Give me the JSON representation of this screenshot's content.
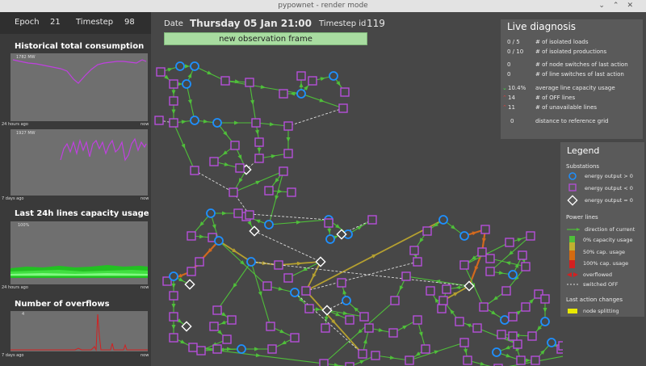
{
  "window": {
    "title": "pypownet - render mode"
  },
  "header": {
    "epoch_label": "Epoch",
    "epoch_value": "21",
    "timestep_label": "Timestep",
    "timestep_value": "98",
    "date_label": "Date",
    "date_value": "Thursday 05 Jan  21:00",
    "timestep_id_label": "Timestep id",
    "timestep_id_value": "119"
  },
  "observation_button": "new observation frame",
  "historical": {
    "title": "Historical total consumption",
    "plot1": {
      "max_label": "1782 MW",
      "left_label": "24 hours ago",
      "right_label": "now"
    },
    "plot2": {
      "max_label": "1927 MW",
      "left_label": "7 days ago",
      "right_label": "now"
    }
  },
  "capacity": {
    "title": "Last 24h lines capacity usage",
    "max_label": "100%",
    "left_label": "24 hours ago",
    "right_label": "now"
  },
  "overflows": {
    "title": "Number of overflows",
    "max_label": "4",
    "left_label": "7 days ago",
    "right_label": "now"
  },
  "diagnosis": {
    "title": "Live diagnosis",
    "rows": [
      {
        "value": "0 / 5",
        "label": "# of isolated loads"
      },
      {
        "value": "0 / 10",
        "label": "# of isolated productions"
      },
      {
        "value": "0",
        "label": "# of node switches of last action"
      },
      {
        "value": "0",
        "label": "# of line switches of last action"
      },
      {
        "value": "10.4%",
        "label": "average line capacity usage",
        "trend": "down"
      },
      {
        "value": "14",
        "label": "# of OFF lines",
        "trend": "up"
      },
      {
        "value": "11",
        "label": "# of unavailable lines",
        "trend": "up"
      },
      {
        "value": "0",
        "label": "distance to reference grid"
      }
    ]
  },
  "legend": {
    "title": "Legend",
    "substations_title": "Substations",
    "substations": [
      "energy output > 0",
      "energy output < 0",
      "energy output = 0"
    ],
    "power_lines_title": "Power lines",
    "power_lines": [
      "direction of current",
      "0% capacity usage",
      "50% cap. usage",
      "100% cap. usage",
      "overflowed",
      "switched OFF"
    ],
    "last_action_title": "Last action changes",
    "last_action": [
      "node splitting"
    ]
  },
  "colors": {
    "load": "#b54fd9",
    "production": "#1e90ff",
    "line_low": "#4fbf3a",
    "line_mid": "#b5a030",
    "line_high": "#d2691e",
    "overflow": "#d42020",
    "switched_off": "#dddddd",
    "node_split": "#e8e800"
  }
}
